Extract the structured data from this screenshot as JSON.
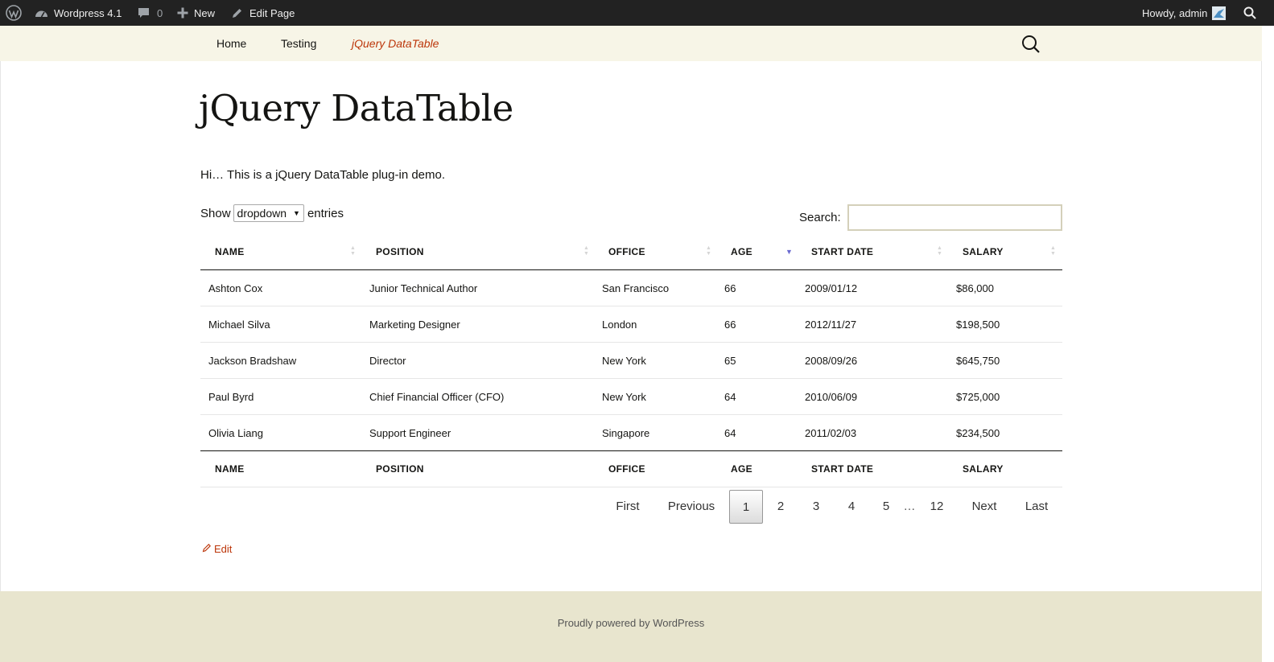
{
  "admin_bar": {
    "site_name": "Wordpress 4.1",
    "comments_count": "0",
    "new_label": "New",
    "edit_label": "Edit Page",
    "greeting": "Howdy, admin"
  },
  "nav": {
    "items": [
      {
        "label": "Home"
      },
      {
        "label": "Testing"
      },
      {
        "label": "jQuery DataTable",
        "current": true
      }
    ]
  },
  "page": {
    "title": "jQuery DataTable",
    "intro": "Hi… This is a jQuery DataTable plug-in demo."
  },
  "table_controls": {
    "show_label": "Show",
    "length_value": "dropdown",
    "entries_label": "entries",
    "search_label": "Search:",
    "search_value": ""
  },
  "table": {
    "columns": [
      "NAME",
      "POSITION",
      "OFFICE",
      "AGE",
      "START DATE",
      "SALARY"
    ],
    "sorted_column": "AGE",
    "sort_direction": "descending",
    "rows": [
      [
        "Ashton Cox",
        "Junior Technical Author",
        "San Francisco",
        "66",
        "2009/01/12",
        "$86,000"
      ],
      [
        "Michael Silva",
        "Marketing Designer",
        "London",
        "66",
        "2012/11/27",
        "$198,500"
      ],
      [
        "Jackson Bradshaw",
        "Director",
        "New York",
        "65",
        "2008/09/26",
        "$645,750"
      ],
      [
        "Paul Byrd",
        "Chief Financial Officer (CFO)",
        "New York",
        "64",
        "2010/06/09",
        "$725,000"
      ],
      [
        "Olivia Liang",
        "Support Engineer",
        "Singapore",
        "64",
        "2011/02/03",
        "$234,500"
      ]
    ]
  },
  "pagination": {
    "first": "First",
    "previous": "Previous",
    "pages": [
      "1",
      "2",
      "3",
      "4",
      "5"
    ],
    "ellipsis": "…",
    "last_page": "12",
    "next": "Next",
    "last": "Last",
    "current_page": "1"
  },
  "edit_link": "Edit",
  "footer": {
    "text": "Proudly powered by WordPress"
  },
  "colors": {
    "accent": "#bc360a",
    "admin_bar": "#222222",
    "nav_bg": "#f7f5e7",
    "footer_bg": "#e8e5ce",
    "sort_active": "#6a6ad0"
  },
  "icons": [
    "wordpress-logo-icon",
    "dashboard-icon",
    "comment-icon",
    "plus-icon",
    "pencil-icon",
    "avatar",
    "admin-search-icon",
    "search-icon",
    "sort-icon",
    "edit-pencil-icon"
  ]
}
